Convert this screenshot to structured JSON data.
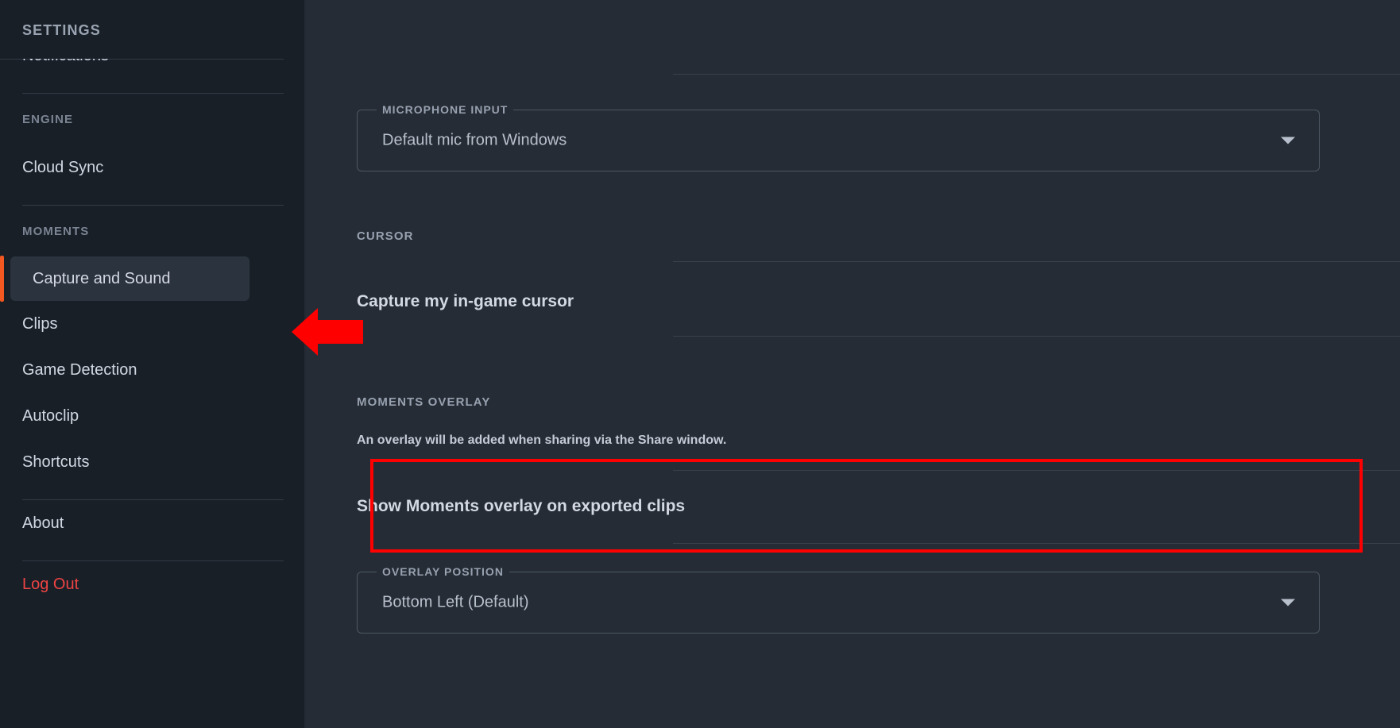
{
  "sidebar": {
    "title": "SETTINGS",
    "clipped_item": "Notifications",
    "groups": [
      {
        "label": "ENGINE",
        "items": [
          "Cloud Sync"
        ]
      },
      {
        "label": "MOMENTS",
        "items": [
          "Capture and Sound",
          "Clips",
          "Game Detection",
          "Autoclip",
          "Shortcuts"
        ]
      }
    ],
    "about_label": "About",
    "logout_label": "Log Out",
    "selected_item": "Capture and Sound",
    "accent_color": "#f2581f",
    "logout_color": "#ef4444"
  },
  "main": {
    "microphone": {
      "legend": "MICROPHONE INPUT",
      "value": "Default mic from Windows",
      "caret": "chevron-down-icon"
    },
    "cursor": {
      "section_label": "CURSOR",
      "row_title": "Capture my in-game cursor",
      "toggle_state": "off"
    },
    "moments_overlay": {
      "section_label": "MOMENTS OVERLAY",
      "helper_text": "An overlay will be added when sharing via the Share window.",
      "row_title": "Show Moments overlay on exported clips",
      "toggle_state": "on",
      "toggle_on_color": "#4f62e8",
      "toggle_off_color": "#5a616e"
    },
    "overlay_position": {
      "legend": "OVERLAY POSITION",
      "value": "Bottom Left (Default)",
      "caret": "chevron-down-icon"
    }
  },
  "annotations": {
    "highlight_color": "#ff0000",
    "arrow_target": "Capture and Sound",
    "box_target": "Show Moments overlay on exported clips"
  }
}
